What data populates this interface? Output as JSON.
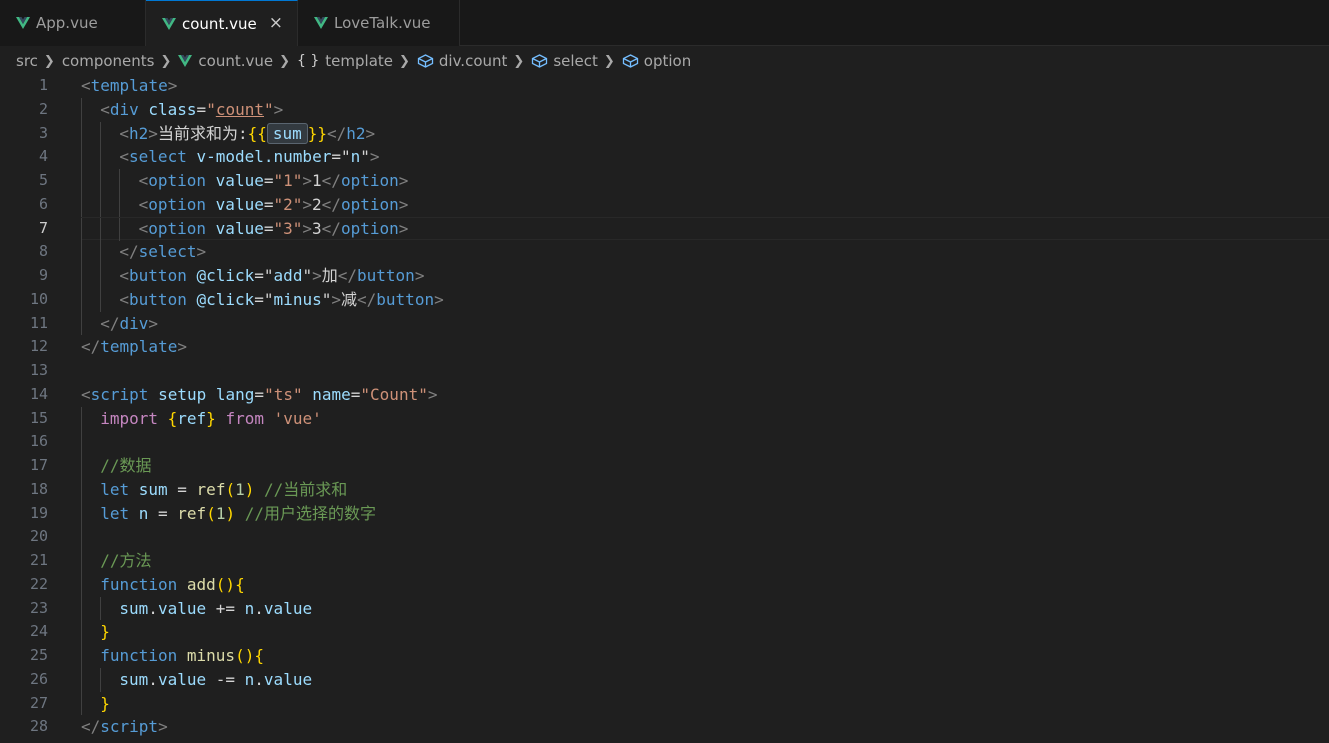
{
  "tabs": [
    {
      "label": "App.vue",
      "active": false
    },
    {
      "label": "count.vue",
      "active": true
    },
    {
      "label": "LoveTalk.vue",
      "active": false
    }
  ],
  "close_glyph": "×",
  "colors": {
    "vue_green": "#41b883",
    "tab_active_border": "#0078d4",
    "editor_bg": "#1f1f1f"
  },
  "breadcrumb": {
    "items": [
      "src",
      "components",
      "count.vue",
      "template",
      "div.count",
      "select",
      "option"
    ],
    "braces": "{ }"
  },
  "editor": {
    "current_line": 7,
    "lines": [
      {
        "n": "1",
        "tokens": [
          {
            "t": "<",
            "c": "punc"
          },
          {
            "t": "template",
            "c": "tag"
          },
          {
            "t": ">",
            "c": "punc"
          }
        ],
        "indent": 0
      },
      {
        "n": "2",
        "tokens": [
          {
            "t": "<",
            "c": "punc"
          },
          {
            "t": "div",
            "c": "tag"
          },
          {
            "t": " ",
            "c": "text"
          },
          {
            "t": "class",
            "c": "attr"
          },
          {
            "t": "=",
            "c": "text"
          },
          {
            "t": "\"",
            "c": "str"
          },
          {
            "t": "count",
            "c": "str under"
          },
          {
            "t": "\"",
            "c": "str"
          },
          {
            "t": ">",
            "c": "punc"
          }
        ],
        "indent": 1
      },
      {
        "n": "3",
        "tokens": [
          {
            "t": "<",
            "c": "punc"
          },
          {
            "t": "h2",
            "c": "tag"
          },
          {
            "t": ">",
            "c": "punc"
          },
          {
            "t": "当前求和为:",
            "c": "text"
          },
          {
            "t": "{{",
            "c": "br1"
          },
          {
            "t": "sum",
            "c": "sum-box"
          },
          {
            "t": "}}",
            "c": "br1"
          },
          {
            "t": "</",
            "c": "punc"
          },
          {
            "t": "h2",
            "c": "tag"
          },
          {
            "t": ">",
            "c": "punc"
          }
        ],
        "indent": 2
      },
      {
        "n": "4",
        "tokens": [
          {
            "t": "<",
            "c": "punc"
          },
          {
            "t": "select",
            "c": "tag"
          },
          {
            "t": " ",
            "c": "text"
          },
          {
            "t": "v-model.number",
            "c": "attr"
          },
          {
            "t": "=",
            "c": "text"
          },
          {
            "t": "\"",
            "c": "text"
          },
          {
            "t": "n",
            "c": "var"
          },
          {
            "t": "\"",
            "c": "text"
          },
          {
            "t": ">",
            "c": "punc"
          }
        ],
        "indent": 2
      },
      {
        "n": "5",
        "tokens": [
          {
            "t": "<",
            "c": "punc"
          },
          {
            "t": "option",
            "c": "tag"
          },
          {
            "t": " ",
            "c": "text"
          },
          {
            "t": "value",
            "c": "attr"
          },
          {
            "t": "=",
            "c": "text"
          },
          {
            "t": "\"1\"",
            "c": "str"
          },
          {
            "t": ">",
            "c": "punc"
          },
          {
            "t": "1",
            "c": "text"
          },
          {
            "t": "</",
            "c": "punc"
          },
          {
            "t": "option",
            "c": "tag"
          },
          {
            "t": ">",
            "c": "punc"
          }
        ],
        "indent": 3
      },
      {
        "n": "6",
        "tokens": [
          {
            "t": "<",
            "c": "punc"
          },
          {
            "t": "option",
            "c": "tag"
          },
          {
            "t": " ",
            "c": "text"
          },
          {
            "t": "value",
            "c": "attr"
          },
          {
            "t": "=",
            "c": "text"
          },
          {
            "t": "\"2\"",
            "c": "str"
          },
          {
            "t": ">",
            "c": "punc"
          },
          {
            "t": "2",
            "c": "text"
          },
          {
            "t": "</",
            "c": "punc"
          },
          {
            "t": "option",
            "c": "tag"
          },
          {
            "t": ">",
            "c": "punc"
          }
        ],
        "indent": 3
      },
      {
        "n": "7",
        "tokens": [
          {
            "t": "<",
            "c": "punc"
          },
          {
            "t": "option",
            "c": "tag"
          },
          {
            "t": " ",
            "c": "text"
          },
          {
            "t": "value",
            "c": "attr"
          },
          {
            "t": "=",
            "c": "text"
          },
          {
            "t": "\"3\"",
            "c": "str"
          },
          {
            "t": ">",
            "c": "punc"
          },
          {
            "t": "3",
            "c": "text"
          },
          {
            "t": "</",
            "c": "punc"
          },
          {
            "t": "option",
            "c": "tag"
          },
          {
            "t": ">",
            "c": "punc"
          }
        ],
        "indent": 3
      },
      {
        "n": "8",
        "tokens": [
          {
            "t": "</",
            "c": "punc"
          },
          {
            "t": "select",
            "c": "tag"
          },
          {
            "t": ">",
            "c": "punc"
          }
        ],
        "indent": 2
      },
      {
        "n": "9",
        "tokens": [
          {
            "t": "<",
            "c": "punc"
          },
          {
            "t": "button",
            "c": "tag"
          },
          {
            "t": " ",
            "c": "text"
          },
          {
            "t": "@click",
            "c": "attr"
          },
          {
            "t": "=",
            "c": "text"
          },
          {
            "t": "\"",
            "c": "text"
          },
          {
            "t": "add",
            "c": "var"
          },
          {
            "t": "\"",
            "c": "text"
          },
          {
            "t": ">",
            "c": "punc"
          },
          {
            "t": "加",
            "c": "text"
          },
          {
            "t": "</",
            "c": "punc"
          },
          {
            "t": "button",
            "c": "tag"
          },
          {
            "t": ">",
            "c": "punc"
          }
        ],
        "indent": 2
      },
      {
        "n": "10",
        "tokens": [
          {
            "t": "<",
            "c": "punc"
          },
          {
            "t": "button",
            "c": "tag"
          },
          {
            "t": " ",
            "c": "text"
          },
          {
            "t": "@click",
            "c": "attr"
          },
          {
            "t": "=",
            "c": "text"
          },
          {
            "t": "\"",
            "c": "text"
          },
          {
            "t": "minus",
            "c": "var"
          },
          {
            "t": "\"",
            "c": "text"
          },
          {
            "t": ">",
            "c": "punc"
          },
          {
            "t": "减",
            "c": "text"
          },
          {
            "t": "</",
            "c": "punc"
          },
          {
            "t": "button",
            "c": "tag"
          },
          {
            "t": ">",
            "c": "punc"
          }
        ],
        "indent": 2
      },
      {
        "n": "11",
        "tokens": [
          {
            "t": "</",
            "c": "punc"
          },
          {
            "t": "div",
            "c": "tag"
          },
          {
            "t": ">",
            "c": "punc"
          }
        ],
        "indent": 1
      },
      {
        "n": "12",
        "tokens": [
          {
            "t": "</",
            "c": "punc"
          },
          {
            "t": "template",
            "c": "tag"
          },
          {
            "t": ">",
            "c": "punc"
          }
        ],
        "indent": 0
      },
      {
        "n": "13",
        "tokens": [],
        "indent": 0
      },
      {
        "n": "14",
        "tokens": [
          {
            "t": "<",
            "c": "punc"
          },
          {
            "t": "script",
            "c": "tag"
          },
          {
            "t": " ",
            "c": "text"
          },
          {
            "t": "setup",
            "c": "attr"
          },
          {
            "t": " ",
            "c": "text"
          },
          {
            "t": "lang",
            "c": "attr"
          },
          {
            "t": "=",
            "c": "text"
          },
          {
            "t": "\"ts\"",
            "c": "str"
          },
          {
            "t": " ",
            "c": "text"
          },
          {
            "t": "name",
            "c": "attr"
          },
          {
            "t": "=",
            "c": "text"
          },
          {
            "t": "\"Count\"",
            "c": "str"
          },
          {
            "t": ">",
            "c": "punc"
          }
        ],
        "indent": 0
      },
      {
        "n": "15",
        "tokens": [
          {
            "t": "import",
            "c": "ctrl"
          },
          {
            "t": " ",
            "c": "text"
          },
          {
            "t": "{",
            "c": "br1"
          },
          {
            "t": "ref",
            "c": "var"
          },
          {
            "t": "}",
            "c": "br1"
          },
          {
            "t": " ",
            "c": "text"
          },
          {
            "t": "from",
            "c": "ctrl"
          },
          {
            "t": " ",
            "c": "text"
          },
          {
            "t": "'vue'",
            "c": "str"
          }
        ],
        "indent": 1
      },
      {
        "n": "16",
        "tokens": [],
        "indent": 1
      },
      {
        "n": "17",
        "tokens": [
          {
            "t": "//数据",
            "c": "cmt"
          }
        ],
        "indent": 1
      },
      {
        "n": "18",
        "tokens": [
          {
            "t": "let",
            "c": "kw"
          },
          {
            "t": " ",
            "c": "text"
          },
          {
            "t": "sum",
            "c": "var"
          },
          {
            "t": " = ",
            "c": "text"
          },
          {
            "t": "ref",
            "c": "fn"
          },
          {
            "t": "(",
            "c": "br1"
          },
          {
            "t": "1",
            "c": "num"
          },
          {
            "t": ")",
            "c": "br1"
          },
          {
            "t": " ",
            "c": "text"
          },
          {
            "t": "//当前求和",
            "c": "cmt"
          }
        ],
        "indent": 1
      },
      {
        "n": "19",
        "tokens": [
          {
            "t": "let",
            "c": "kw"
          },
          {
            "t": " ",
            "c": "text"
          },
          {
            "t": "n",
            "c": "var"
          },
          {
            "t": " = ",
            "c": "text"
          },
          {
            "t": "ref",
            "c": "fn"
          },
          {
            "t": "(",
            "c": "br1"
          },
          {
            "t": "1",
            "c": "num"
          },
          {
            "t": ")",
            "c": "br1"
          },
          {
            "t": " ",
            "c": "text"
          },
          {
            "t": "//用户选择的数字",
            "c": "cmt"
          }
        ],
        "indent": 1
      },
      {
        "n": "20",
        "tokens": [],
        "indent": 1
      },
      {
        "n": "21",
        "tokens": [
          {
            "t": "//方法",
            "c": "cmt"
          }
        ],
        "indent": 1
      },
      {
        "n": "22",
        "tokens": [
          {
            "t": "function",
            "c": "kw"
          },
          {
            "t": " ",
            "c": "text"
          },
          {
            "t": "add",
            "c": "fn"
          },
          {
            "t": "(){",
            "c": "br1"
          }
        ],
        "indent": 1
      },
      {
        "n": "23",
        "tokens": [
          {
            "t": "sum",
            "c": "var"
          },
          {
            "t": ".",
            "c": "text"
          },
          {
            "t": "value",
            "c": "var"
          },
          {
            "t": " += ",
            "c": "text"
          },
          {
            "t": "n",
            "c": "var"
          },
          {
            "t": ".",
            "c": "text"
          },
          {
            "t": "value",
            "c": "var"
          }
        ],
        "indent": 2
      },
      {
        "n": "24",
        "tokens": [
          {
            "t": "}",
            "c": "br1"
          }
        ],
        "indent": 1
      },
      {
        "n": "25",
        "tokens": [
          {
            "t": "function",
            "c": "kw"
          },
          {
            "t": " ",
            "c": "text"
          },
          {
            "t": "minus",
            "c": "fn"
          },
          {
            "t": "(){",
            "c": "br1"
          }
        ],
        "indent": 1
      },
      {
        "n": "26",
        "tokens": [
          {
            "t": "sum",
            "c": "var"
          },
          {
            "t": ".",
            "c": "text"
          },
          {
            "t": "value",
            "c": "var"
          },
          {
            "t": " -= ",
            "c": "text"
          },
          {
            "t": "n",
            "c": "var"
          },
          {
            "t": ".",
            "c": "text"
          },
          {
            "t": "value",
            "c": "var"
          }
        ],
        "indent": 2
      },
      {
        "n": "27",
        "tokens": [
          {
            "t": "}",
            "c": "br1"
          }
        ],
        "indent": 1
      },
      {
        "n": "28",
        "tokens": [
          {
            "t": "</",
            "c": "punc"
          },
          {
            "t": "script",
            "c": "tag"
          },
          {
            "t": ">",
            "c": "punc"
          }
        ],
        "indent": 0
      }
    ]
  }
}
